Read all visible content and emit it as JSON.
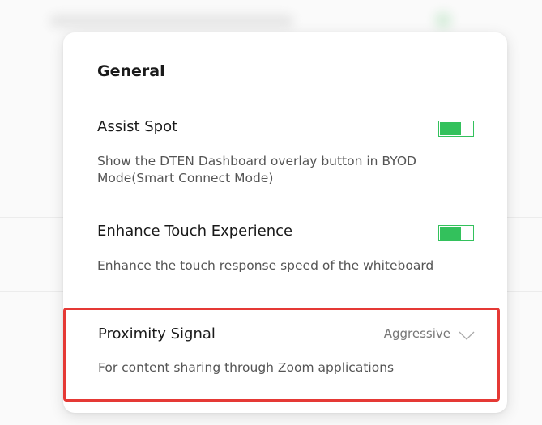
{
  "panel": {
    "section_title": "General",
    "assist_spot": {
      "title": "Assist Spot",
      "description": "Show the DTEN Dashboard overlay button in BYOD Mode(Smart Connect Mode)",
      "enabled": true
    },
    "enhance_touch": {
      "title": "Enhance Touch Experience",
      "description": "Enhance the touch response speed of the whiteboard",
      "enabled": true
    },
    "proximity_signal": {
      "title": "Proximity Signal",
      "selected_value": "Aggressive",
      "description": "For content sharing through Zoom applications"
    }
  },
  "icons": {
    "dropdown": "chevron-down-icon"
  },
  "colors": {
    "toggle_on": "#33c15c",
    "highlight": "#e53935",
    "text_primary": "#1a1a1a",
    "text_secondary": "#555555"
  }
}
